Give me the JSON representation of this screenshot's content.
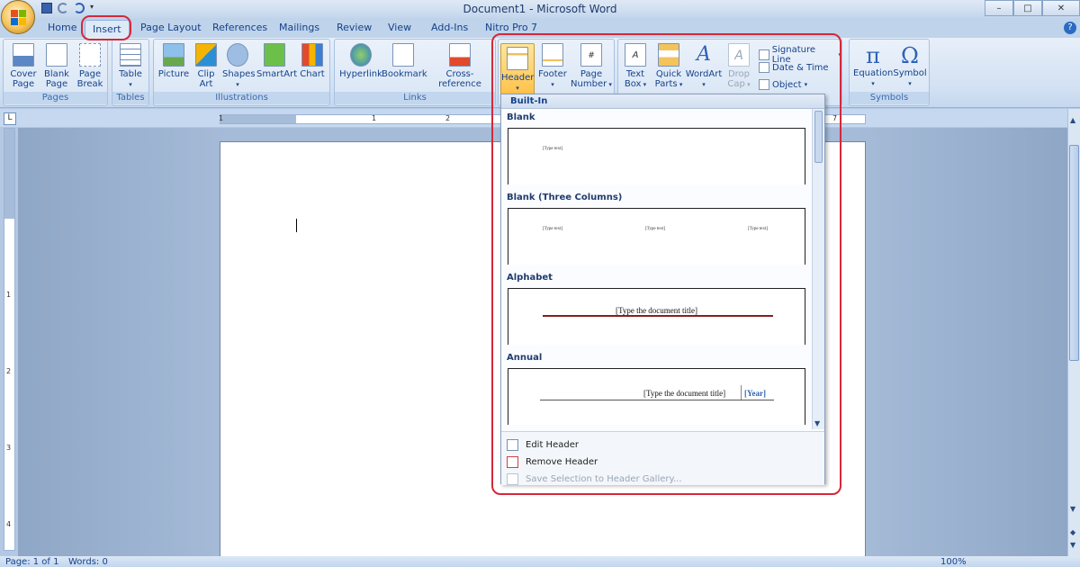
{
  "window": {
    "title": "Document1 - Microsoft Word",
    "minimize": "–",
    "restore": "□",
    "close": "✕"
  },
  "ribbon_tabs": [
    "Home",
    "Insert",
    "Page Layout",
    "References",
    "Mailings",
    "Review",
    "View",
    "Add-Ins",
    "Nitro Pro 7"
  ],
  "active_tab": "Insert",
  "groups": {
    "pages": {
      "label": "Pages",
      "cover": "Cover",
      "cover2": "Page",
      "blank": "Blank",
      "blank2": "Page",
      "break": "Page",
      "break2": "Break"
    },
    "tables": {
      "label": "Tables",
      "table": "Table"
    },
    "illustrations": {
      "label": "Illustrations",
      "picture": "Picture",
      "clip": "Clip",
      "clip2": "Art",
      "shapes": "Shapes",
      "smartart": "SmartArt",
      "chart": "Chart"
    },
    "links": {
      "label": "Links",
      "hyperlink": "Hyperlink",
      "bookmark": "Bookmark",
      "crossref": "Cross-reference"
    },
    "header_footer": {
      "header": "Header",
      "footer": "Footer",
      "pagenum": "Page",
      "pagenum2": "Number"
    },
    "text": {
      "textbox": "Text",
      "textbox2": "Box",
      "quickparts": "Quick",
      "quickparts2": "Parts",
      "wordart": "WordArt",
      "dropcap": "Drop",
      "dropcap2": "Cap",
      "sigline": "Signature Line",
      "datetime": "Date & Time",
      "object": "Object"
    },
    "symbols": {
      "label": "Symbols",
      "equation": "Equation",
      "symbol": "Symbol",
      "pi": "π",
      "omega": "Ω"
    }
  },
  "ruler_numbers": [
    "1",
    "1",
    "2",
    "7"
  ],
  "vruler_numbers": [
    "1",
    "2",
    "3",
    "4"
  ],
  "gallery": {
    "section": "Built-In",
    "items": [
      {
        "title": "Blank",
        "placeholders": [
          "[Type text]"
        ]
      },
      {
        "title": "Blank (Three Columns)",
        "placeholders": [
          "[Type text]",
          "[Type text]",
          "[Type text]"
        ]
      },
      {
        "title": "Alphabet",
        "placeholders": [
          "[Type the document title]"
        ]
      },
      {
        "title": "Annual",
        "placeholders": [
          "[Type the document title]",
          "[Year]"
        ]
      }
    ],
    "edit_header": "Edit Header",
    "remove_header": "Remove Header",
    "save_selection": "Save Selection to Header Gallery..."
  },
  "status": {
    "page": "Page: 1 of 1",
    "words": "Words: 0",
    "zoom": "100%"
  },
  "colors": {
    "callout": "#d5283a",
    "ribbon": "#d3e1f3",
    "highlight": "#ffc24a"
  }
}
